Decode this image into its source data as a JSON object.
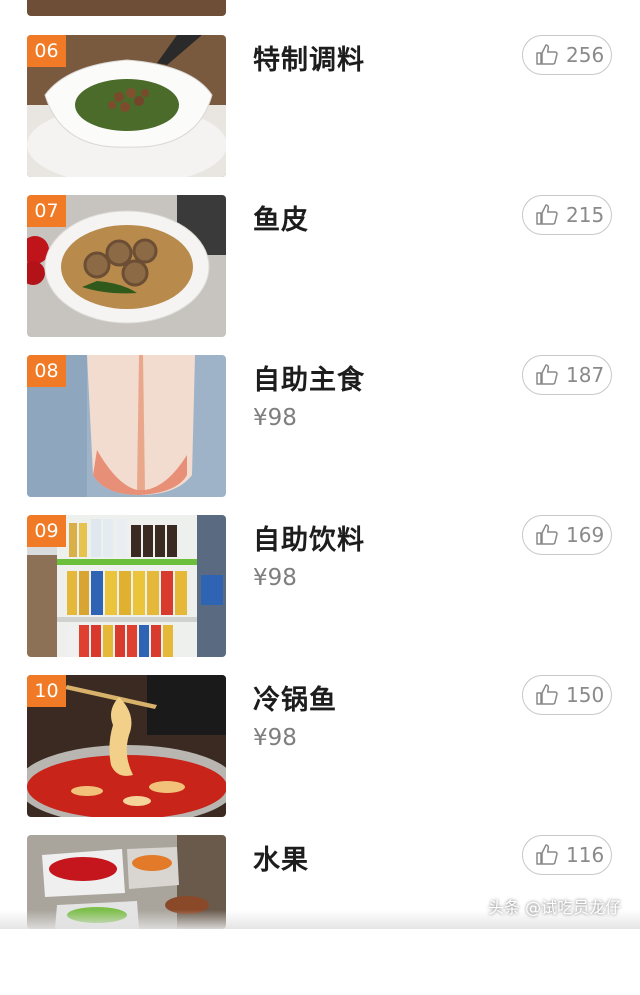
{
  "list": {
    "items": [
      {
        "rank": "06",
        "name": "特制调料",
        "price": "",
        "likes": "256",
        "image": "sauce-bowl-with-herbs-and-peanuts"
      },
      {
        "rank": "07",
        "name": "鱼皮",
        "price": "",
        "likes": "215",
        "image": "fish-skin-rolls-in-bowl"
      },
      {
        "rank": "08",
        "name": "自助主食",
        "price": "¥98",
        "likes": "187",
        "image": "sliced-fish-fillet"
      },
      {
        "rank": "09",
        "name": "自助饮料",
        "price": "¥98",
        "likes": "169",
        "image": "drinks-shelf"
      },
      {
        "rank": "10",
        "name": "冷锅鱼",
        "price": "¥98",
        "likes": "150",
        "image": "fish-in-red-hotpot"
      },
      {
        "rank": "",
        "name": "水果",
        "price": "",
        "likes": "116",
        "image": "fruit-buffet"
      }
    ]
  },
  "watermark": "头条 @试吃员龙仔",
  "icons": {
    "like": "thumbs-up-icon"
  },
  "colors": {
    "rank_badge": "#f07a25",
    "title": "#1d1d1d",
    "price": "#7e7e7e",
    "like_border": "#c8c8c8"
  }
}
